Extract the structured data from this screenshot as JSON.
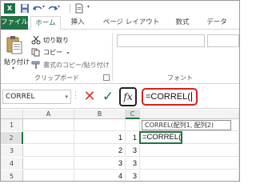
{
  "app": {
    "logo": "X",
    "accent": "#217346",
    "quick_access_icons": [
      "save-icon",
      "undo-icon",
      "redo-icon",
      "new-doc-icon",
      "customize-icon"
    ]
  },
  "tabs": {
    "file": "ファイル",
    "home": "ホーム",
    "insert": "挿入",
    "page_layout": "ページ レイアウト",
    "formulas": "数式",
    "data": "データ"
  },
  "ribbon": {
    "paste_label": "貼り付け",
    "cut_label": "切り取り",
    "copy_label": "コピー",
    "copy_arrow": "▾",
    "format_painter_label": "書式のコピー/貼り付け",
    "clipboard_group": "クリップボード",
    "font_group": "フォント"
  },
  "formula_bar": {
    "name_box": "CORREL",
    "cancel": "✕",
    "enter": "✓",
    "fx": "fx",
    "formula": "=CORREL("
  },
  "grid": {
    "columns": [
      "A",
      "B",
      "C"
    ],
    "rows": [
      {
        "num": "1",
        "a": "",
        "b": "",
        "c": ""
      },
      {
        "num": "2",
        "a": "",
        "b": "1",
        "c": "1"
      },
      {
        "num": "3",
        "a": "",
        "b": "2",
        "c": "3"
      },
      {
        "num": "4",
        "a": "",
        "b": "3",
        "c": "3"
      },
      {
        "num": "5",
        "a": "",
        "b": "4",
        "c": "3"
      },
      {
        "num": "6",
        "a": "",
        "b": "5",
        "c": "7"
      }
    ],
    "active_cell_text": "=CORREL(",
    "tooltip": "CORREL(配列1, 配列2)"
  }
}
